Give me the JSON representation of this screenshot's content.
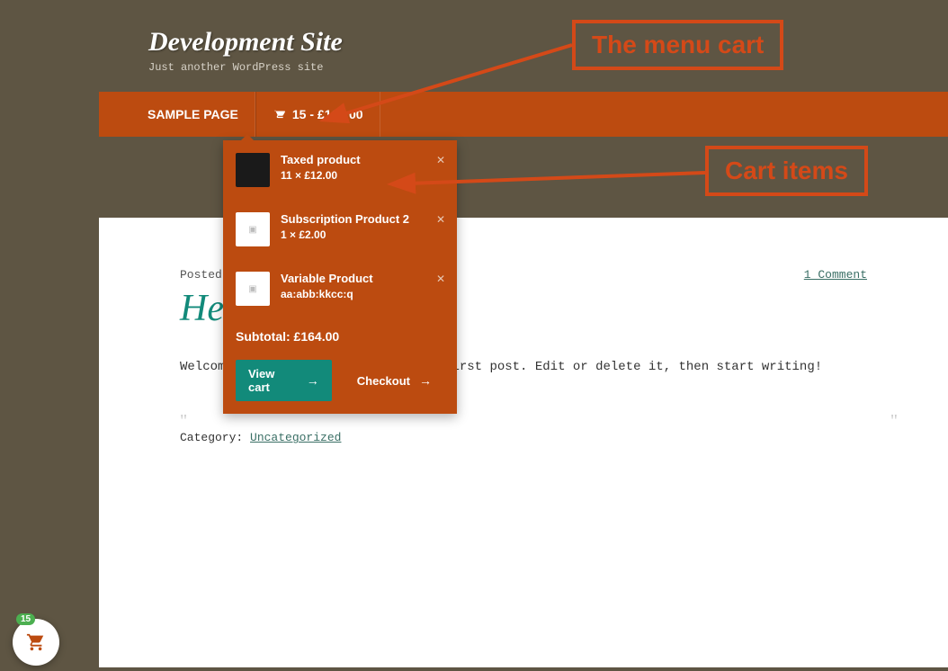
{
  "site": {
    "title": "Development Site",
    "tagline": "Just another WordPress site"
  },
  "nav": {
    "sample_page": "SAMPLE PAGE",
    "cart_count": "15",
    "cart_total": "£164.00"
  },
  "dropdown": {
    "items": [
      {
        "name": "Taxed product",
        "qty": "11 × £12.00",
        "thumb": "dark"
      },
      {
        "name": "Subscription Product 2",
        "qty": "1 × £2.00",
        "thumb": "light"
      },
      {
        "name": "Variable Product",
        "qty": "aa:abb:kkcc:q",
        "thumb": "light"
      }
    ],
    "subtotal_label": "Subtotal:",
    "subtotal_value": "£164.00",
    "view_cart": "View cart",
    "checkout": "Checkout"
  },
  "post": {
    "meta_prefix": "Posted on",
    "comments": "1 Comment",
    "title_visible": "He",
    "body": "Welcome to WordPress. This is your first post. Edit or delete it, then start writing!",
    "body_visible_left": "Welco",
    "category_label": "Category: ",
    "category": "Uncategorized"
  },
  "annotations": {
    "menu_cart": "The menu cart",
    "cart_items": "Cart items"
  },
  "float": {
    "badge": "15"
  }
}
